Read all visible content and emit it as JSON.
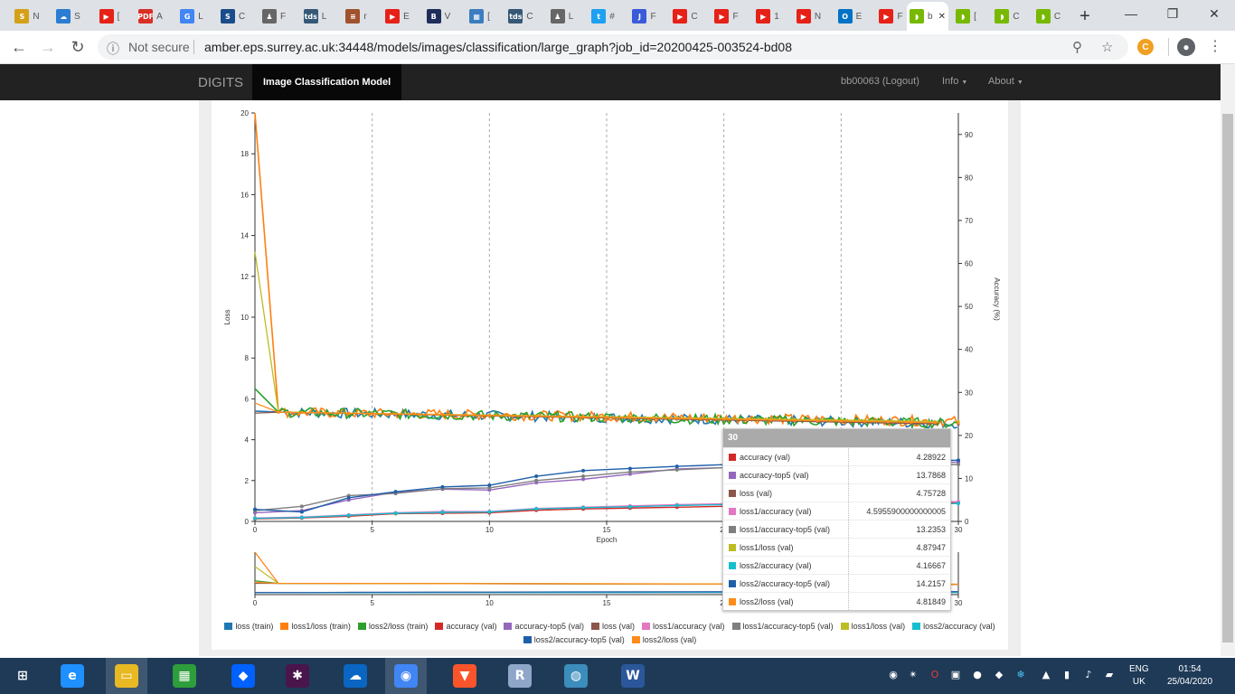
{
  "browser": {
    "tabs": [
      {
        "icon": "surrey-icon",
        "label": "N",
        "color": "#d4a017",
        "glyph": "S"
      },
      {
        "icon": "cloud-icon",
        "label": "S",
        "color": "#2b7cd3",
        "glyph": "☁"
      },
      {
        "icon": "youtube-icon",
        "label": "[",
        "color": "#e62117",
        "glyph": "▶"
      },
      {
        "icon": "pdf-icon",
        "label": "A",
        "color": "#d93025",
        "glyph": "PDF"
      },
      {
        "icon": "google-scholar-icon",
        "label": "L",
        "color": "#4285f4",
        "glyph": "G"
      },
      {
        "icon": "surrey-icon",
        "label": "C",
        "color": "#1a4c8b",
        "glyph": "S"
      },
      {
        "icon": "person-icon",
        "label": "F",
        "color": "#666666",
        "glyph": "♟"
      },
      {
        "icon": "tds-icon",
        "label": "L",
        "color": "#355876",
        "glyph": "tds"
      },
      {
        "icon": "paper-icon",
        "label": "r",
        "color": "#a0522d",
        "glyph": "≡"
      },
      {
        "icon": "youtube-icon",
        "label": "E",
        "color": "#e62117",
        "glyph": "▶"
      },
      {
        "icon": "book-icon",
        "label": "V",
        "color": "#1f2d5a",
        "glyph": "B"
      },
      {
        "icon": "diagram-icon",
        "label": "[",
        "color": "#3b7dbf",
        "glyph": "▦"
      },
      {
        "icon": "tds-icon",
        "label": "C",
        "color": "#355876",
        "glyph": "tds"
      },
      {
        "icon": "person-icon",
        "label": "L",
        "color": "#666666",
        "glyph": "♟"
      },
      {
        "icon": "twitter-icon",
        "label": "#",
        "color": "#1da1f2",
        "glyph": "t"
      },
      {
        "icon": "app-icon",
        "label": "F",
        "color": "#3a5bd9",
        "glyph": "J"
      },
      {
        "icon": "youtube-icon",
        "label": "C",
        "color": "#e62117",
        "glyph": "▶"
      },
      {
        "icon": "youtube-icon",
        "label": "F",
        "color": "#e62117",
        "glyph": "▶"
      },
      {
        "icon": "youtube-icon",
        "label": "1",
        "color": "#e62117",
        "glyph": "▶"
      },
      {
        "icon": "youtube-icon",
        "label": "N",
        "color": "#e62117",
        "glyph": "▶"
      },
      {
        "icon": "outlook-icon",
        "label": "E",
        "color": "#0072c6",
        "glyph": "O"
      },
      {
        "icon": "youtube-icon",
        "label": "F",
        "color": "#e62117",
        "glyph": "▶"
      },
      {
        "icon": "nvidia-icon",
        "label": "b",
        "color": "#76b900",
        "glyph": "◗"
      },
      {
        "icon": "nvidia-icon",
        "label": "b",
        "color": "#76b900",
        "glyph": "◗",
        "active": true
      },
      {
        "icon": "nvidia-icon",
        "label": "[",
        "color": "#76b900",
        "glyph": "◗"
      },
      {
        "icon": "nvidia-icon",
        "label": "C",
        "color": "#76b900",
        "glyph": "◗"
      },
      {
        "icon": "nvidia-icon",
        "label": "C",
        "color": "#76b900",
        "glyph": "◗"
      }
    ],
    "address": {
      "security": "Not secure",
      "url": "amber.eps.surrey.ac.uk:34448/models/images/classification/large_graph?job_id=20200425-003524-bd08"
    }
  },
  "navbar": {
    "brand": "DIGITS",
    "active": "Image Classification Model",
    "user": "bb00063 (Logout)",
    "info": "Info",
    "about": "About"
  },
  "chart_data": [
    {
      "type": "line",
      "xlabel": "Epoch",
      "ylabel": "Loss",
      "y2label": "Accuracy (%)",
      "xlim": [
        0,
        30
      ],
      "ylim": [
        0,
        20
      ],
      "y2lim": [
        0,
        95
      ],
      "xticks": [
        0,
        5,
        10,
        15,
        20,
        25,
        30
      ],
      "yticks": [
        0,
        2,
        4,
        6,
        8,
        10,
        12,
        14,
        16,
        18,
        20
      ],
      "y2ticks": [
        0,
        10,
        20,
        30,
        40,
        50,
        60,
        70,
        80,
        90
      ],
      "grid": "vertical",
      "series": [
        {
          "name": "loss (train)",
          "color": "#1f77b4",
          "axis": "loss",
          "start": 5.4,
          "end": 4.8
        },
        {
          "name": "loss1/loss (train)",
          "color": "#ff7f0e",
          "axis": "loss",
          "start": 20.0,
          "end": 4.9
        },
        {
          "name": "loss2/loss (train)",
          "color": "#2ca02c",
          "axis": "loss",
          "start": 6.5,
          "end": 4.8
        },
        {
          "name": "accuracy (val)",
          "color": "#d62728",
          "axis": "accuracy",
          "x": [
            0,
            2,
            4,
            6,
            8,
            10,
            12,
            14,
            16,
            18,
            20,
            22,
            24,
            26,
            28,
            30
          ],
          "values": [
            0.6,
            0.8,
            1.2,
            1.8,
            1.9,
            2.0,
            2.6,
            2.9,
            3.1,
            3.3,
            3.5,
            3.7,
            3.9,
            4.0,
            4.2,
            4.29
          ]
        },
        {
          "name": "accuracy-top5 (val)",
          "color": "#9467bd",
          "axis": "accuracy",
          "x": [
            0,
            2,
            4,
            6,
            8,
            10,
            12,
            14,
            16,
            18,
            20,
            22,
            24,
            26,
            28,
            30
          ],
          "values": [
            2.0,
            2.5,
            5.0,
            6.8,
            7.5,
            7.3,
            9.0,
            9.8,
            11.0,
            12.2,
            12.5,
            12.8,
            13.0,
            13.3,
            13.6,
            13.79
          ]
        },
        {
          "name": "loss (val)",
          "color": "#8c564b",
          "axis": "loss",
          "start": 5.3,
          "end": 4.76
        },
        {
          "name": "loss1/accuracy (val)",
          "color": "#e377c2",
          "axis": "accuracy",
          "x": [
            0,
            2,
            4,
            6,
            8,
            10,
            12,
            14,
            16,
            18,
            20,
            22,
            24,
            26,
            28,
            30
          ],
          "values": [
            0.8,
            1.0,
            1.5,
            2.0,
            2.3,
            2.3,
            3.0,
            3.3,
            3.6,
            3.9,
            4.1,
            4.3,
            4.4,
            4.5,
            4.55,
            4.6
          ]
        },
        {
          "name": "loss1/accuracy-top5 (val)",
          "color": "#7f7f7f",
          "axis": "accuracy",
          "x": [
            0,
            2,
            4,
            6,
            8,
            10,
            12,
            14,
            16,
            18,
            20,
            22,
            24,
            26,
            28,
            30
          ],
          "values": [
            2.5,
            3.5,
            6.0,
            6.5,
            7.6,
            7.8,
            9.5,
            10.5,
            11.5,
            12.0,
            12.5,
            12.7,
            12.9,
            13.0,
            13.1,
            13.24
          ]
        },
        {
          "name": "loss1/loss (val)",
          "color": "#bcbd22",
          "axis": "loss",
          "start": 13.2,
          "end": 4.88
        },
        {
          "name": "loss2/accuracy (val)",
          "color": "#17becf",
          "axis": "accuracy",
          "x": [
            0,
            2,
            4,
            6,
            8,
            10,
            12,
            14,
            16,
            18,
            20,
            22,
            24,
            26,
            28,
            30
          ],
          "values": [
            0.7,
            0.9,
            1.4,
            1.9,
            2.1,
            2.2,
            2.9,
            3.2,
            3.4,
            3.7,
            3.9,
            4.0,
            4.1,
            4.1,
            4.15,
            4.17
          ]
        },
        {
          "name": "loss2/accuracy-top5 (val)",
          "color": "#1f5fa8",
          "axis": "accuracy",
          "x": [
            0,
            2,
            4,
            6,
            8,
            10,
            12,
            14,
            16,
            18,
            20,
            22,
            24,
            26,
            28,
            30
          ],
          "values": [
            2.8,
            2.2,
            5.5,
            6.9,
            8.0,
            8.4,
            10.5,
            11.8,
            12.3,
            12.8,
            13.2,
            13.5,
            13.8,
            14.0,
            14.1,
            14.22
          ]
        },
        {
          "name": "loss2/loss (val)",
          "color": "#ff8c1a",
          "axis": "loss",
          "start": 5.8,
          "end": 4.82
        }
      ]
    }
  ],
  "tooltip": {
    "header": "30",
    "rows": [
      {
        "name": "accuracy (val)",
        "value": "4.28922",
        "color": "#d62728"
      },
      {
        "name": "accuracy-top5 (val)",
        "value": "13.7868",
        "color": "#9467bd"
      },
      {
        "name": "loss (val)",
        "value": "4.75728",
        "color": "#8c564b"
      },
      {
        "name": "loss1/accuracy (val)",
        "value": "4.5955900000000005",
        "color": "#e377c2"
      },
      {
        "name": "loss1/accuracy-top5 (val)",
        "value": "13.2353",
        "color": "#7f7f7f"
      },
      {
        "name": "loss1/loss (val)",
        "value": "4.87947",
        "color": "#bcbd22"
      },
      {
        "name": "loss2/accuracy (val)",
        "value": "4.16667",
        "color": "#17becf"
      },
      {
        "name": "loss2/accuracy-top5 (val)",
        "value": "14.2157",
        "color": "#1f5fa8"
      },
      {
        "name": "loss2/loss (val)",
        "value": "4.81849",
        "color": "#ff8c1a"
      }
    ]
  },
  "taskbar": {
    "apps": [
      {
        "name": "start-button",
        "glyph": "⊞",
        "color": "#1e3a57"
      },
      {
        "name": "internet-explorer-icon",
        "glyph": "e",
        "color": "#1e90ff"
      },
      {
        "name": "file-explorer-icon",
        "glyph": "▭",
        "color": "#e8b923"
      },
      {
        "name": "store-icon",
        "glyph": "▦",
        "color": "#2e9d3b"
      },
      {
        "name": "dropbox-icon",
        "glyph": "◆",
        "color": "#0061fe"
      },
      {
        "name": "slack-icon",
        "glyph": "✱",
        "color": "#4a154b"
      },
      {
        "name": "onedrive-icon",
        "glyph": "☁",
        "color": "#0a66c2"
      },
      {
        "name": "chrome-icon",
        "glyph": "◉",
        "color": "#4285f4"
      },
      {
        "name": "brave-icon",
        "glyph": "▼",
        "color": "#fb542b"
      },
      {
        "name": "r-icon",
        "glyph": "R",
        "color": "#8fa6c8"
      },
      {
        "name": "globe-icon",
        "glyph": "◍",
        "color": "#3c8dbc"
      },
      {
        "name": "word-icon",
        "glyph": "W",
        "color": "#2b579a"
      }
    ],
    "lang1": "ENG",
    "lang2": "UK",
    "time": "01:54",
    "date": "25/04/2020"
  }
}
